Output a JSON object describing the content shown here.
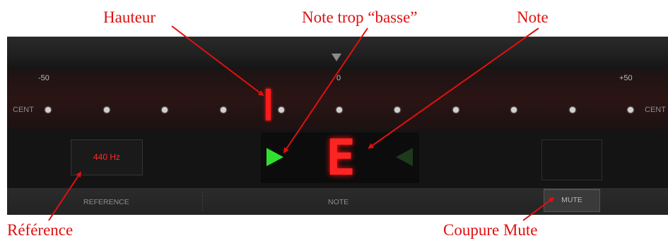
{
  "annotations": {
    "hauteur": "Hauteur",
    "note_basse": "Note trop “basse”",
    "note": "Note",
    "reference": "Référence",
    "coupure_mute": "Coupure Mute"
  },
  "tuner": {
    "scale": {
      "left_label": "-50",
      "center_label": "0",
      "right_label": "+50",
      "cent_label": "CENT"
    },
    "reference_value": "440 Hz",
    "detected_note": "E",
    "pitch_offset_cents": -10,
    "bottom": {
      "reference_label": "REFERENCE",
      "note_label": "NOTE",
      "mute_label": "MUTE"
    }
  },
  "colors": {
    "annotation": "#e01010",
    "display_red": "#ff2424",
    "arrow_green": "#2fe02f"
  }
}
